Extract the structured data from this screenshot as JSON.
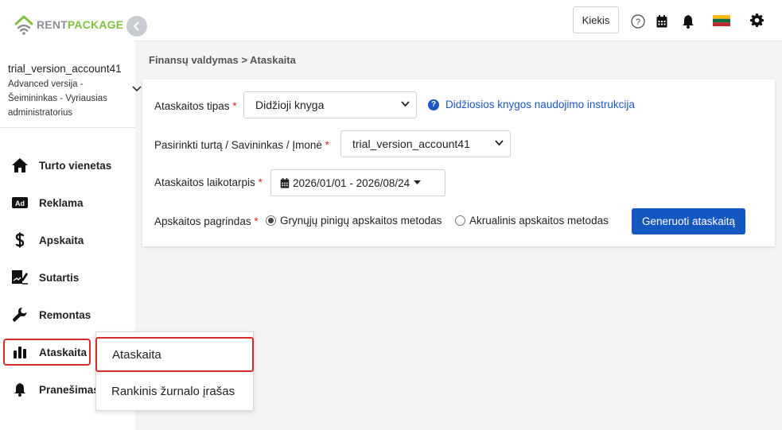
{
  "brand": {
    "rent": "RENT",
    "package": "PACKAGE"
  },
  "account": {
    "name": "trial_version_account41",
    "line1": "Advanced versija -",
    "line2": "Šeimininkas - Vyriausias",
    "line3": "administratorius"
  },
  "sidebar": {
    "items": [
      {
        "label": "Turto vienetas"
      },
      {
        "label": "Reklama"
      },
      {
        "label": "Apskaita"
      },
      {
        "label": "Sutartis"
      },
      {
        "label": "Remontas"
      },
      {
        "label": "Ataskaita"
      },
      {
        "label": "Pranešimas"
      }
    ]
  },
  "topbar": {
    "kiekis_label": "Kiekis",
    "help_glyph": "?"
  },
  "breadcrumb": {
    "text": "Finansų valdymas > Ataskaita"
  },
  "form": {
    "report_type_label": "Ataskaitos tipas",
    "report_type_value": "Didžioji knyga",
    "help_link": "Didžiosios knygos naudojimo instrukcija",
    "asset_label": "Pasirinkti turtą / Savininkas / Įmonė",
    "asset_value": "trial_version_account41",
    "period_label": "Ataskaitos laikotarpis",
    "period_value": "2026/01/01 - 2026/08/24",
    "basis_label": "Apskaitos pagrindas",
    "basis_option1": "Grynųjų pinigų apskaitos metodas",
    "basis_option2": "Akrualinis apskaitos metodas",
    "generate_button": "Generuoti ataskaitą",
    "required_mark": "*"
  },
  "submenu": {
    "items": [
      {
        "label": "Ataskaita"
      },
      {
        "label": "Rankinis žurnalo įrašas"
      }
    ]
  },
  "colors": {
    "accent": "#1557c0",
    "brand_green": "#7fc242",
    "highlight_red": "#d62b2b"
  }
}
